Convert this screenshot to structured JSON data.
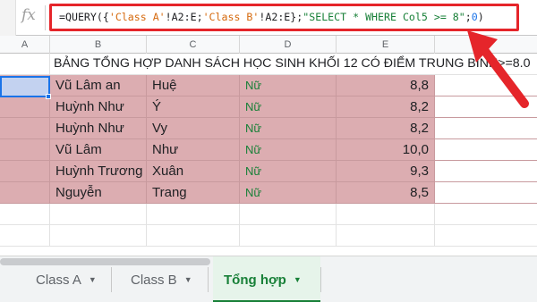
{
  "formula_bar": {
    "fx_label": "fx",
    "formula_parts": {
      "p1": "=QUERY({",
      "p2": "'Class A'",
      "p3": "!A2:E;",
      "p4": "'Class B'",
      "p5": "!A2:E};",
      "p6": "\"SELECT * WHERE Col5 >= 8\"",
      "p7": ";",
      "p8": "0",
      "p9": ")"
    }
  },
  "columns": [
    "A",
    "B",
    "C",
    "D",
    "E",
    "F"
  ],
  "sheet_title": "BẢNG TỔNG HỢP DANH SÁCH HỌC SINH KHỐI 12 CÓ ĐIỂM TRUNG BÌNH>=8.0",
  "rows": [
    {
      "ho": "Vũ Lâm an",
      "ten": "Huệ",
      "gioi_tinh": "Nữ",
      "diem": "8,8"
    },
    {
      "ho": "Huỳnh Như",
      "ten": "Ý",
      "gioi_tinh": "Nữ",
      "diem": "8,2"
    },
    {
      "ho": "Huỳnh Như",
      "ten": "Vy",
      "gioi_tinh": "Nữ",
      "diem": "8,2"
    },
    {
      "ho": "Vũ Lâm",
      "ten": "Như",
      "gioi_tinh": "Nữ",
      "diem": "10,0"
    },
    {
      "ho": "Huỳnh Trương",
      "ten": "Xuân",
      "gioi_tinh": "Nữ",
      "diem": "9,3"
    },
    {
      "ho": "Nguyễn",
      "ten": "Trang",
      "gioi_tinh": "Nữ",
      "diem": "8,5"
    }
  ],
  "tabs": [
    {
      "label": "Class A",
      "active": false
    },
    {
      "label": "Class B",
      "active": false
    },
    {
      "label": "Tổng hợp",
      "active": true
    }
  ],
  "colors": {
    "highlight": "#dcadb1",
    "accent_red": "#e5252a",
    "active_tab": "#188038",
    "selection": "#1a73e8"
  },
  "icons": {
    "tab_menu": "caret-down-icon",
    "annotation": "red-arrow-icon"
  }
}
